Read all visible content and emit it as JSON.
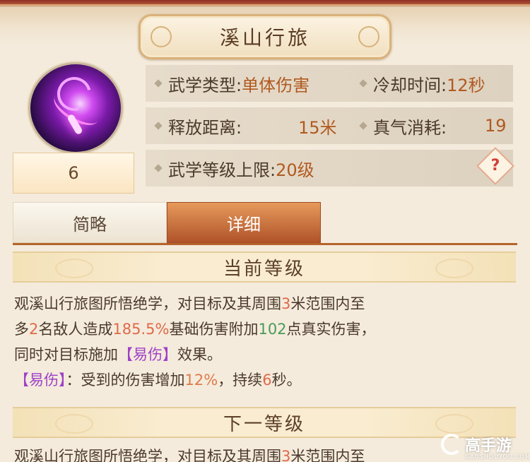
{
  "skill": {
    "title": "溪山行旅",
    "level": "6",
    "icon": "purple-energy-skill-icon"
  },
  "stats": {
    "type_label": "武学类型:",
    "type_value": "单体伤害",
    "cooldown_label": "冷却时间:",
    "cooldown_value": "12秒",
    "range_label": "释放距离:",
    "range_value": "15米",
    "energy_label": "真气消耗:",
    "energy_value": "19",
    "max_level_label": "武学等级上限:",
    "max_level_value": "20级",
    "help": "?"
  },
  "tabs": {
    "brief": "简略",
    "detail": "详细",
    "active": "detail"
  },
  "sections": {
    "current": "当前等级",
    "next": "下一等级"
  },
  "current_desc": {
    "l1a": "观溪山行旅图所悟绝学，对目标及其周围",
    "l1b": "3",
    "l1c": "米范围内至",
    "l2a": "多",
    "l2b": "2",
    "l2c": "名敌人造成",
    "l2d": "185.5%",
    "l2e": "基础伤害附加",
    "l2f": "102",
    "l2g": "点真实伤害，",
    "l3a": "同时对目标施加",
    "l3b": "【易伤】",
    "l3c": "效果。",
    "l4a": "【易伤】",
    "l4b": "：受到的伤害增加",
    "l4c": "12%",
    "l4d": "，持续",
    "l4e": "6",
    "l4f": "秒。"
  },
  "next_desc": {
    "l1a": "观溪山行旅图所悟绝学，对目标及其周围",
    "l1b": "3",
    "l1c": "米范围内至"
  },
  "watermark": {
    "text": "高手游",
    "sub": "GAOSHOUYOU.COM"
  },
  "colors": {
    "accent": "#b05a20",
    "tab_active": "#b0532a",
    "highlight_red": "#e06a4a",
    "highlight_green": "#4a9a5a",
    "highlight_purple": "#a040c8"
  }
}
